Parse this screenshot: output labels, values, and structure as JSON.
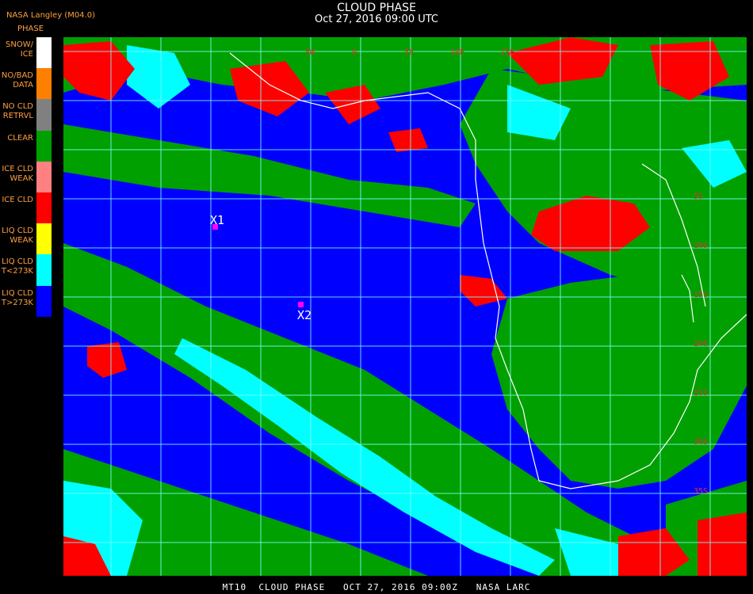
{
  "header": {
    "title": "CLOUD PHASE",
    "subtitle": "Oct 27, 2016 09:00 UTC",
    "producer": "NASA Langley (M04.0)"
  },
  "legend": {
    "title": "PHASE",
    "items": [
      {
        "label": "SNOW/\nICE",
        "color": "#ffffff"
      },
      {
        "label": "NO/BAD\nDATA",
        "color": "#ff8000"
      },
      {
        "label": "NO CLD\nRETRVL",
        "color": "#808080"
      },
      {
        "label": "CLEAR",
        "color": "#00a000"
      },
      {
        "label": "ICE CLD\nWEAK",
        "color": "#ff8080"
      },
      {
        "label": "ICE CLD",
        "color": "#ff0000"
      },
      {
        "label": "LIQ CLD\nWEAK",
        "color": "#ffff00"
      },
      {
        "label": "LIQ CLD\nT<273K",
        "color": "#00ffff"
      },
      {
        "label": "LIQ CLD\nT>273K",
        "color": "#0000ff"
      }
    ]
  },
  "map": {
    "grid_color": "#80ffff",
    "coast_color": "#ffffff",
    "lon_labels": [
      "5W",
      "0",
      "5E",
      "10E",
      "15E"
    ],
    "lat_labels": [
      "5S",
      "10S",
      "15S",
      "20S",
      "25S",
      "30S",
      "35S"
    ],
    "markers": [
      {
        "label": "X1",
        "color": "#ff00ff"
      },
      {
        "label": "X2",
        "color": "#ff00ff"
      }
    ]
  },
  "footer": {
    "text": "MT10  CLOUD PHASE   OCT 27, 2016 09:00Z   NASA LARC"
  }
}
